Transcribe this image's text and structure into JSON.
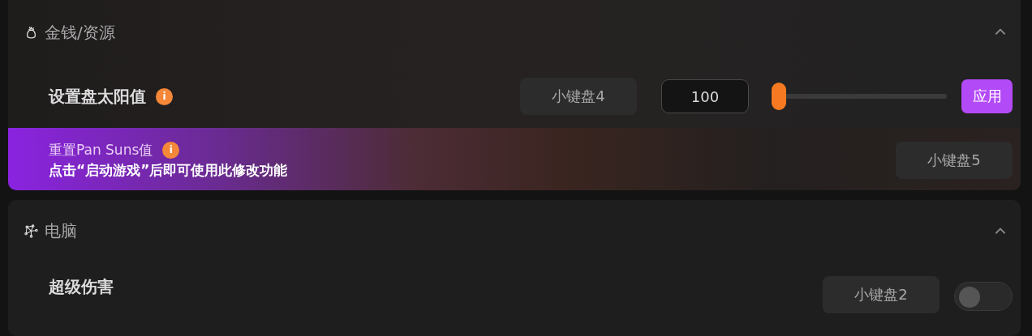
{
  "sections": [
    {
      "title": "金钱/资源",
      "expanded": true,
      "rows": [
        {
          "kind": "slider",
          "label": "设置盘太阳值",
          "info": "i",
          "hotkey": "小键盘4",
          "value": "100",
          "level": 0,
          "apply": "应用"
        },
        {
          "kind": "button",
          "label": "重置Pan Suns值",
          "info": "i",
          "notice": "点击“启动游戏”后即可使用此修改功能",
          "hotkey": "小键盘5"
        }
      ]
    },
    {
      "title": "电脑",
      "expanded": true,
      "rows": [
        {
          "kind": "toggle",
          "label": "超级伤害",
          "hotkey": "小键盘2",
          "on": false
        }
      ]
    }
  ]
}
